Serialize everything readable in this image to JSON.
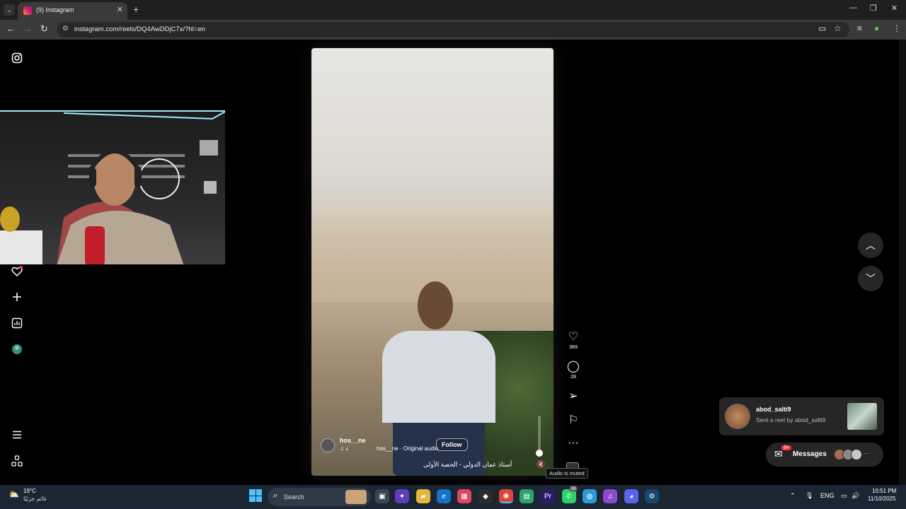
{
  "browser": {
    "tab_title": "(9) Instagram",
    "url": "instagram.com/reels/DQ4AwDDjC7x/?hl=en",
    "new_tab_icon": "plus-icon",
    "window_controls": [
      "minimize",
      "restore",
      "close"
    ]
  },
  "sidebar": {
    "items": [
      {
        "icon": "instagram-logo-icon"
      },
      {
        "icon": "heart-icon",
        "badge": true
      },
      {
        "icon": "plus-icon"
      },
      {
        "icon": "chart-icon"
      },
      {
        "icon": "profile-avatar"
      },
      {
        "icon": "menu-icon"
      },
      {
        "icon": "apps-icon"
      }
    ]
  },
  "reel": {
    "username": "hos__ne",
    "music_label": "♫ د",
    "audio_label": "hos__ne · Original audio",
    "follow_label": "Follow",
    "caption": "أستاذ عمان الدولي - الحصة الأولى",
    "actions": {
      "like_count": "389",
      "comment_count": "28"
    },
    "muted_tooltip": "Audio is muted"
  },
  "notification": {
    "name": "abod_salti9",
    "text": "Sent a reel by abod_salti9"
  },
  "messages": {
    "label": "Messages",
    "badge": "9+"
  },
  "taskbar": {
    "weather_temp": "19°C",
    "weather_desc": "غائم جزئيًا",
    "search_label": "Search",
    "language": "ENG",
    "time": "10:51 PM",
    "date": "11/10/2025",
    "chat_badge": "38"
  },
  "colors": {
    "accent": "#0095f6",
    "badge": "#ff3040",
    "taskbar": "#1c2633"
  }
}
